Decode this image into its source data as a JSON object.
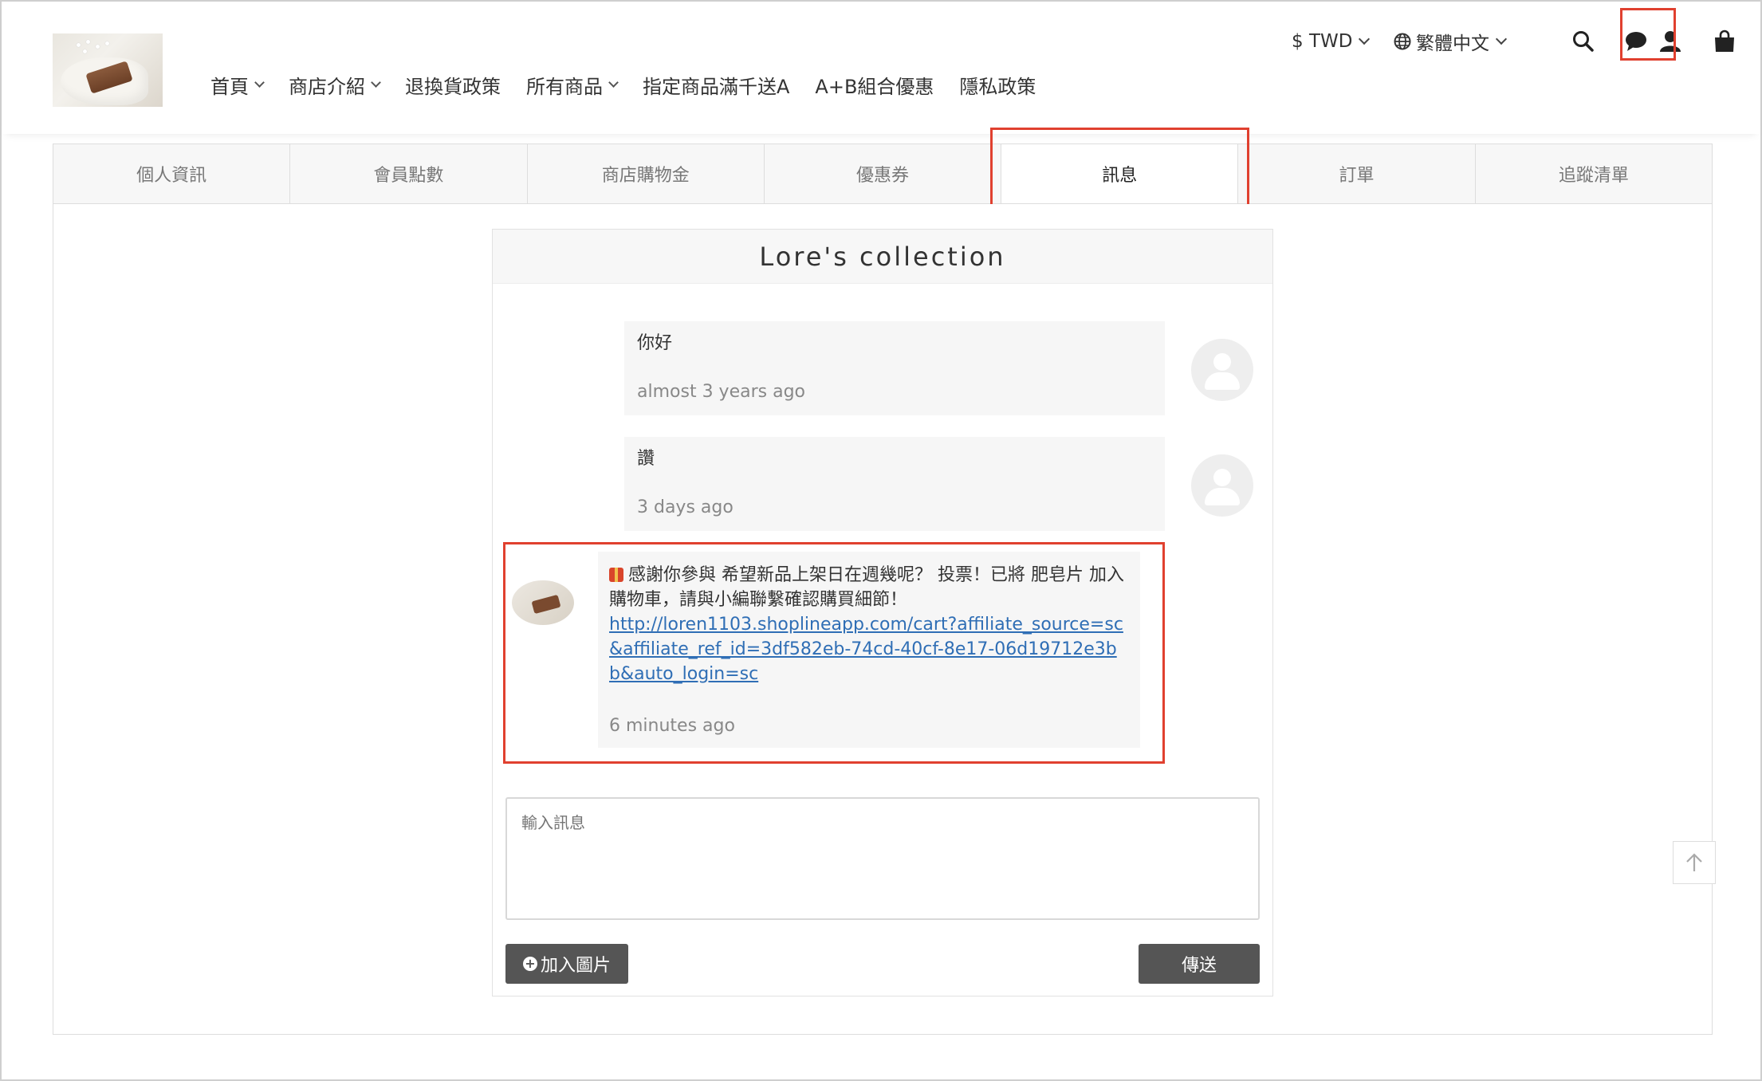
{
  "header": {
    "currency": "$ TWD",
    "language": "繁體中文",
    "nav": [
      "首頁",
      "商店介紹",
      "退換貨政策",
      "所有商品",
      "指定商品滿千送A",
      "A+B組合優惠",
      "隱私政策"
    ],
    "icons": {
      "currency": "dollar-icon",
      "language": "globe-icon",
      "search": "search-icon",
      "chat": "chat-bubble-icon",
      "user": "user-icon",
      "cart": "shopping-bag-icon"
    }
  },
  "tabs": [
    "個人資訊",
    "會員點數",
    "商店購物金",
    "優惠券",
    "訊息",
    "訂單",
    "追蹤清單"
  ],
  "active_tab": "訊息",
  "chat": {
    "title": "Lore's collection",
    "messages": [
      {
        "text": "你好",
        "time": "almost 3 years ago"
      },
      {
        "text": "讚",
        "time": "3 days ago"
      },
      {
        "text": "感謝你參與 希望新品上架日在週幾呢？ 投票！已將 肥皂片 加入購物車，請與小編聯繫確認購買細節！",
        "link": "http://loren1103.shoplineapp.com/cart?affiliate_source=sc&affiliate_ref_id=3df582eb-74cd-40cf-8e17-06d19712e3bb&auto_login=sc",
        "time": "6 minutes ago"
      }
    ],
    "input_placeholder": "輸入訊息",
    "add_image_label": "加入圖片",
    "send_label": "傳送"
  },
  "colors": {
    "highlight": "#e0402f",
    "link": "#2f6eb5",
    "button": "#555555"
  }
}
